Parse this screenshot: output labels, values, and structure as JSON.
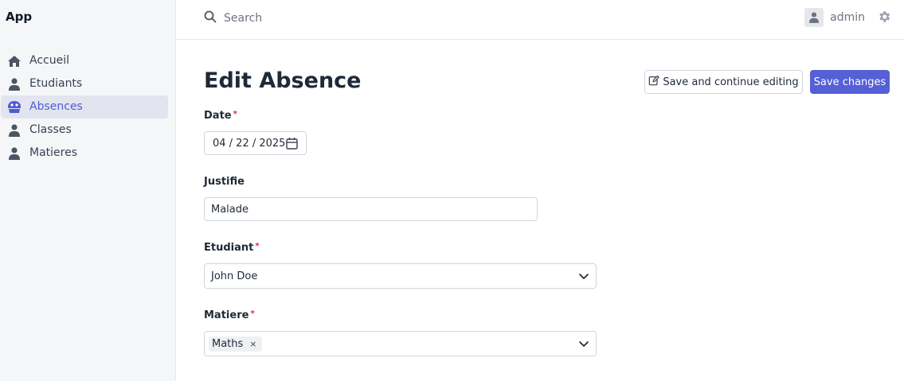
{
  "app": {
    "title": "App"
  },
  "sidebar": {
    "items": [
      {
        "label": "Accueil",
        "icon": "home-icon",
        "active": false
      },
      {
        "label": "Etudiants",
        "icon": "user-icon",
        "active": false
      },
      {
        "label": "Absences",
        "icon": "absence-icon",
        "active": true
      },
      {
        "label": "Classes",
        "icon": "user-icon",
        "active": false
      },
      {
        "label": "Matieres",
        "icon": "user-icon",
        "active": false
      }
    ]
  },
  "topbar": {
    "search_placeholder": "Search",
    "user_name": "admin"
  },
  "page": {
    "title": "Edit Absence",
    "save_continue_label": "Save and continue editing",
    "save_label": "Save changes"
  },
  "form": {
    "date": {
      "label": "Date",
      "required_mark": "*",
      "value": "04 / 22 / 2025"
    },
    "justifie": {
      "label": "Justifie",
      "value": "Malade"
    },
    "etudiant": {
      "label": "Etudiant",
      "required_mark": "*",
      "value": "John Doe"
    },
    "matiere": {
      "label": "Matiere",
      "required_mark": "*",
      "tag": "Maths",
      "tag_remove": "×"
    }
  },
  "colors": {
    "accent": "#5560d6",
    "active_bg": "#e2e5ef",
    "required": "#e11d48"
  }
}
